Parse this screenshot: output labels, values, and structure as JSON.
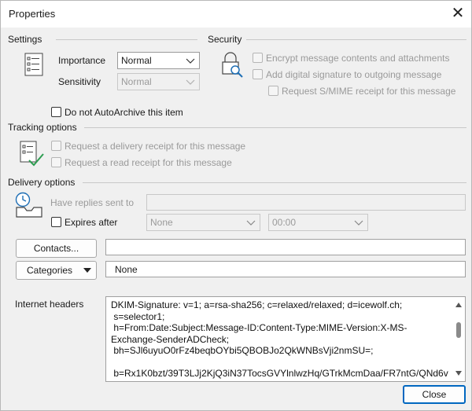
{
  "window": {
    "title": "Properties",
    "close_glyph": "✕"
  },
  "settings": {
    "section_title": "Settings",
    "importance_label": "Importance",
    "importance_value": "Normal",
    "sensitivity_label": "Sensitivity",
    "sensitivity_value": "Normal",
    "autoarchive_label": "Do not AutoArchive this item",
    "autoarchive_checked": false
  },
  "security": {
    "section_title": "Security",
    "encrypt_label": "Encrypt message contents and attachments",
    "signature_label": "Add digital signature to outgoing message",
    "smime_label": "Request S/MIME receipt for this message"
  },
  "tracking": {
    "section_title": "Tracking options",
    "delivery_receipt_label": "Request a delivery receipt for this message",
    "read_receipt_label": "Request a read receipt for this message"
  },
  "delivery": {
    "section_title": "Delivery options",
    "replies_label": "Have replies sent to",
    "replies_value": "",
    "expires_label": "Expires after",
    "expires_date": "None",
    "expires_time": "00:00"
  },
  "contacts": {
    "button_label": "Contacts...",
    "value": ""
  },
  "categories": {
    "button_label": "Categories",
    "value": "None"
  },
  "headers": {
    "label": "Internet headers",
    "text": "DKIM-Signature: v=1; a=rsa-sha256; c=relaxed/relaxed; d=icewolf.ch;\n s=selector1;\n h=From:Date:Subject:Message-ID:Content-Type:MIME-Version:X-MS-\nExchange-SenderADCheck;\n bh=SJl6uyuO0rFz4beqbOYbi5QBOBJo2QkWNBsVji2nmSU=;\n\n b=Rx1K0bzt/39T3LJj2KjQ3iN37TocsGVYlnlwzHq/GTrkMcmDaa/FR7ntG/QNd6v"
  },
  "footer": {
    "close_label": "Close"
  },
  "colors": {
    "accent": "#0067c0",
    "background": "#f0f0f0",
    "disabled_text": "#9a9a9a"
  },
  "icons": [
    "close-icon",
    "settings-list-icon",
    "security-lock-icon",
    "tracking-checklist-icon",
    "delivery-clock-tray-icon",
    "chevron-down-icon",
    "triangle-down-icon"
  ]
}
